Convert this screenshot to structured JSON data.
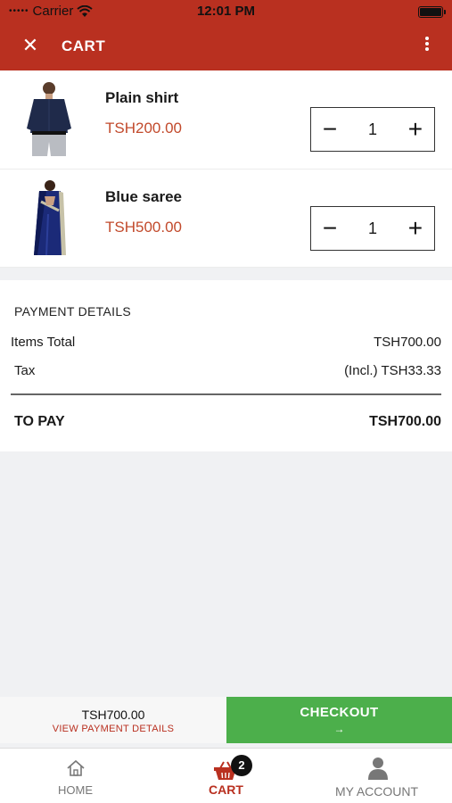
{
  "status_bar": {
    "carrier": "Carrier",
    "time": "12:01 PM"
  },
  "app_bar": {
    "title": "CART"
  },
  "cart_items": [
    {
      "name": "Plain shirt",
      "price": "TSH200.00",
      "quantity": "1",
      "image": "shirt-thumbnail"
    },
    {
      "name": "Blue saree",
      "price": "TSH500.00",
      "quantity": "1",
      "image": "saree-thumbnail"
    }
  ],
  "payment": {
    "heading": "PAYMENT DETAILS",
    "items_total_label": "Items Total",
    "items_total_value": "TSH700.00",
    "tax_label": "Tax",
    "tax_value": "(Incl.) TSH33.33",
    "to_pay_label": "TO PAY",
    "to_pay_value": "TSH700.00"
  },
  "bottom_bar": {
    "amount": "TSH700.00",
    "view_details": "VIEW PAYMENT DETAILS",
    "checkout_label": "CHECKOUT",
    "checkout_arrow": "→"
  },
  "tabs": {
    "home": "HOME",
    "cart": "CART",
    "cart_badge": "2",
    "account": "MY ACCOUNT"
  },
  "colors": {
    "brand": "#b93020",
    "price": "#c24a2c",
    "checkout": "#4caf4b"
  }
}
